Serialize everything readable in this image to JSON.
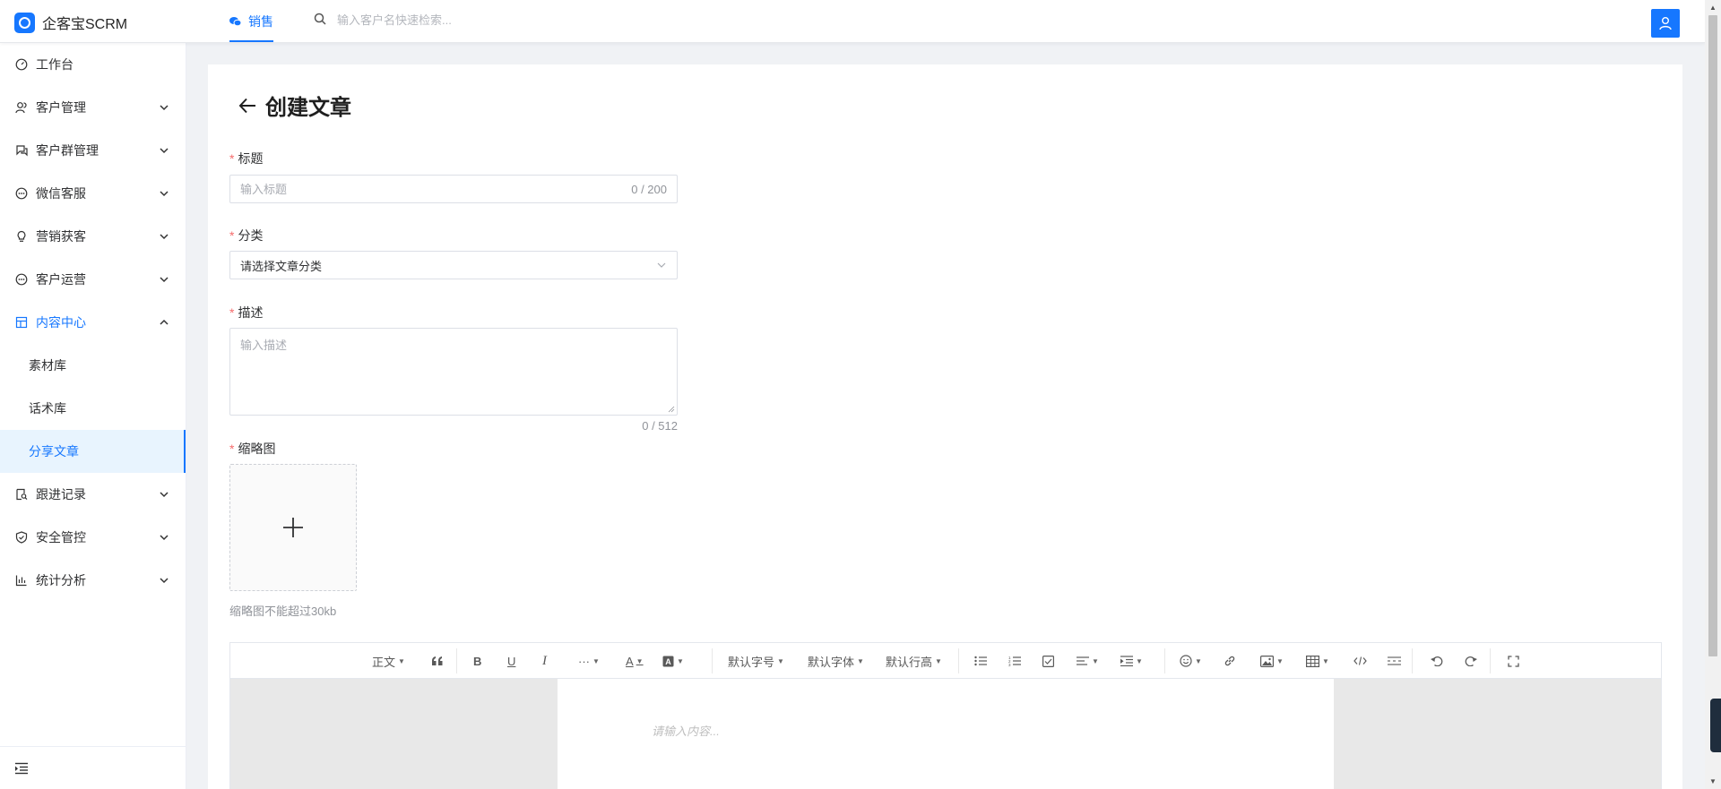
{
  "app": {
    "name": "企客宝SCRM"
  },
  "header": {
    "tab": "销售",
    "search_placeholder": "输入客户名快速检索..."
  },
  "sidebar": {
    "items": [
      {
        "label": "工作台"
      },
      {
        "label": "客户管理"
      },
      {
        "label": "客户群管理"
      },
      {
        "label": "微信客服"
      },
      {
        "label": "营销获客"
      },
      {
        "label": "客户运营"
      },
      {
        "label": "内容中心"
      },
      {
        "label": "跟进记录"
      },
      {
        "label": "安全管控"
      },
      {
        "label": "统计分析"
      }
    ],
    "sub_items": [
      {
        "label": "素材库"
      },
      {
        "label": "话术库"
      },
      {
        "label": "分享文章"
      }
    ]
  },
  "page": {
    "title": "创建文章",
    "form": {
      "title_label": "标题",
      "title_placeholder": "输入标题",
      "title_count": "0 / 200",
      "category_label": "分类",
      "category_value": "请选择文章分类",
      "desc_label": "描述",
      "desc_placeholder": "输入描述",
      "desc_count": "0 / 512",
      "thumb_label": "缩略图",
      "thumb_tip": "缩略图不能超过30kb",
      "required_mark": "*"
    }
  },
  "editor": {
    "toolbar": {
      "paragraph": "正文",
      "font_size": "默认字号",
      "font_family": "默认字体",
      "line_height": "默认行高",
      "bold": "B",
      "underline": "U",
      "italic": "I",
      "more": "···",
      "font_color": "A"
    },
    "placeholder": "请输入内容..."
  },
  "colors": {
    "primary": "#1677ff",
    "required": "#f56c6c"
  }
}
